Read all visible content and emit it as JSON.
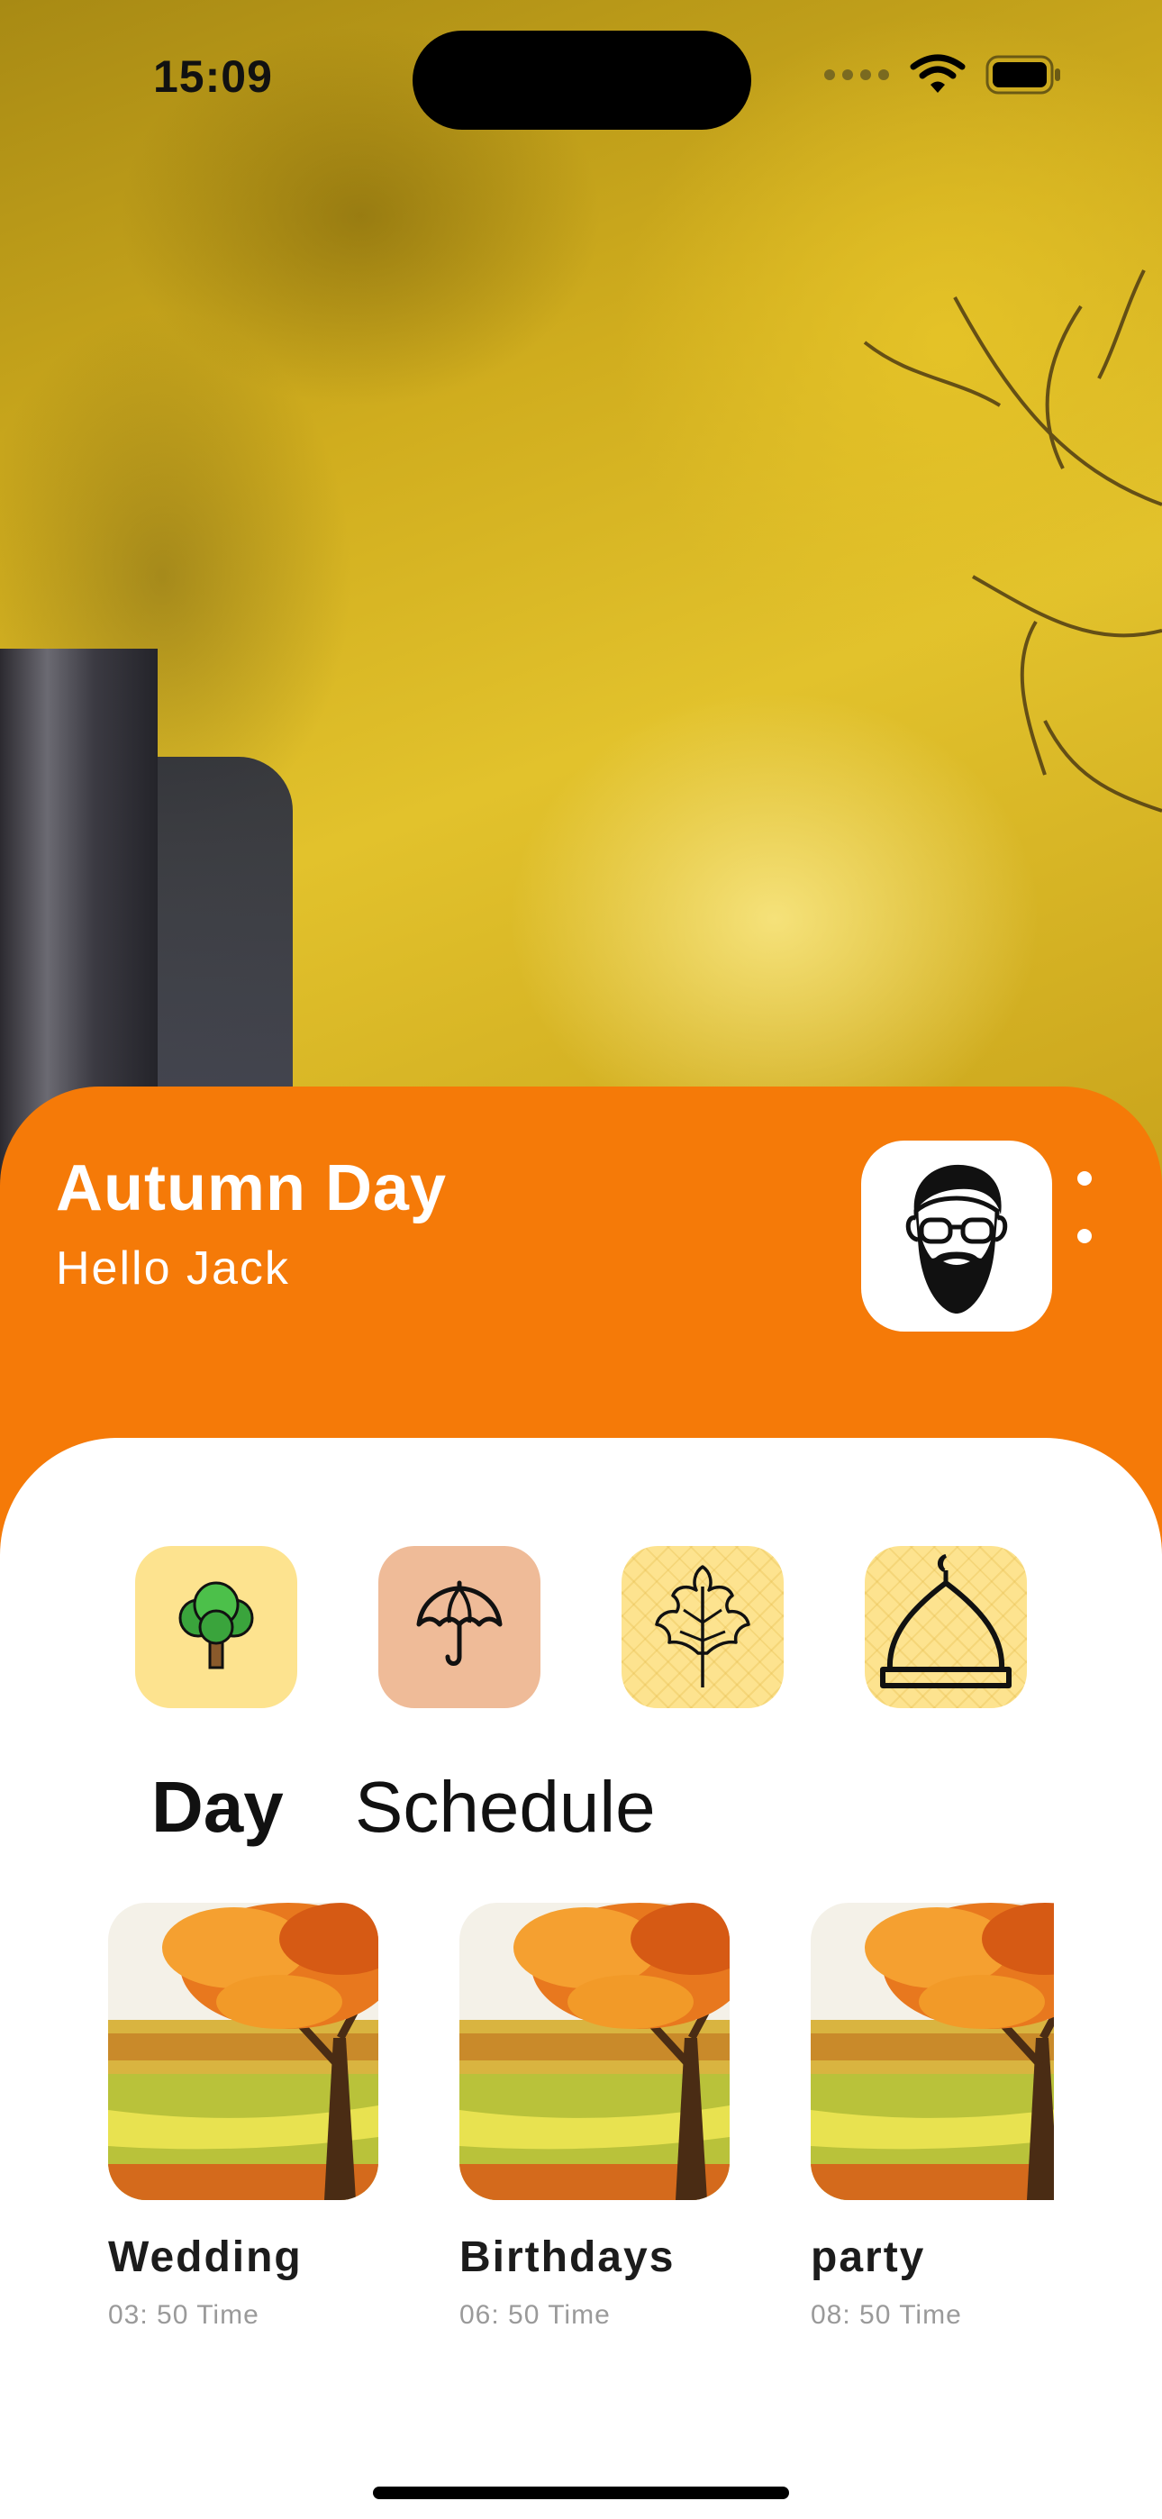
{
  "status_bar": {
    "time": "15:09"
  },
  "header": {
    "title": "Autumn Day",
    "greeting": "Hello Jack",
    "avatar_icon": "bearded-man-avatar",
    "menu_icon": "more-vertical-icon"
  },
  "categories": [
    {
      "icon": "tree-icon"
    },
    {
      "icon": "umbrella-icon"
    },
    {
      "icon": "maple-leaf-icon"
    },
    {
      "icon": "dome-icon"
    }
  ],
  "tabs": [
    {
      "label": "Day",
      "selected": true
    },
    {
      "label": "Schedule",
      "selected": false
    }
  ],
  "events": [
    {
      "title": "Wedding",
      "time": "03: 50 Time"
    },
    {
      "title": "Birthdays",
      "time": "06: 50 Time"
    },
    {
      "title": "party",
      "time": "08: 50 Time"
    }
  ],
  "colors": {
    "accent": "#f57a08",
    "card_background": "#ffffff",
    "category_yellow": "#fde38f",
    "category_peach": "#efbb98"
  }
}
